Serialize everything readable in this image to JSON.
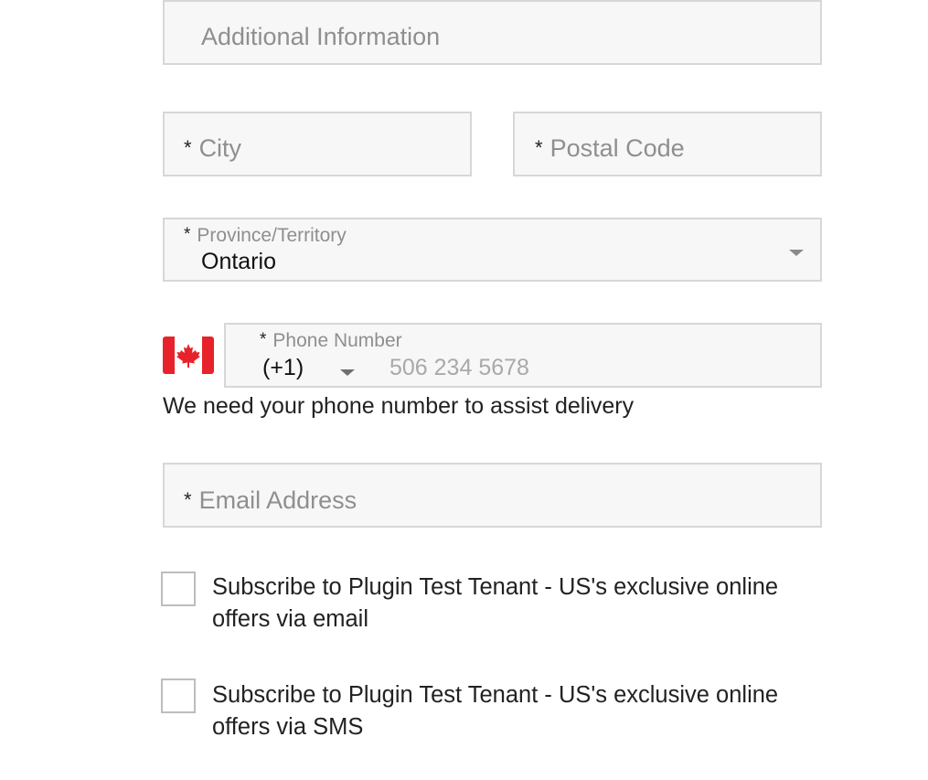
{
  "address": {
    "additional_info": {
      "placeholder": "Additional Information"
    },
    "city": {
      "required_marker": "*",
      "placeholder": "City"
    },
    "postal_code": {
      "required_marker": "*",
      "placeholder": "Postal Code"
    },
    "province": {
      "required_marker": "*",
      "label": "Province/Territory",
      "selected": "Ontario",
      "icon": "chevron-down-icon"
    }
  },
  "phone": {
    "flag_icon": "canada-flag-icon",
    "required_marker": "*",
    "label": "Phone Number",
    "country_code": "(+1)",
    "country_code_icon": "chevron-down-icon",
    "placeholder": "506 234 5678",
    "helper_text": "We need your phone number to assist delivery"
  },
  "email": {
    "required_marker": "*",
    "placeholder": "Email Address"
  },
  "subscriptions": [
    {
      "label": "Subscribe to Plugin Test Tenant - US's exclusive online offers via email",
      "checked": false
    },
    {
      "label": "Subscribe to Plugin Test Tenant - US's exclusive online offers via SMS",
      "checked": false
    }
  ],
  "colors": {
    "flag_red": "#e8222a",
    "field_background": "#f7f7f7",
    "field_border": "#d7d7d7",
    "placeholder_text": "#8f8f8f"
  }
}
